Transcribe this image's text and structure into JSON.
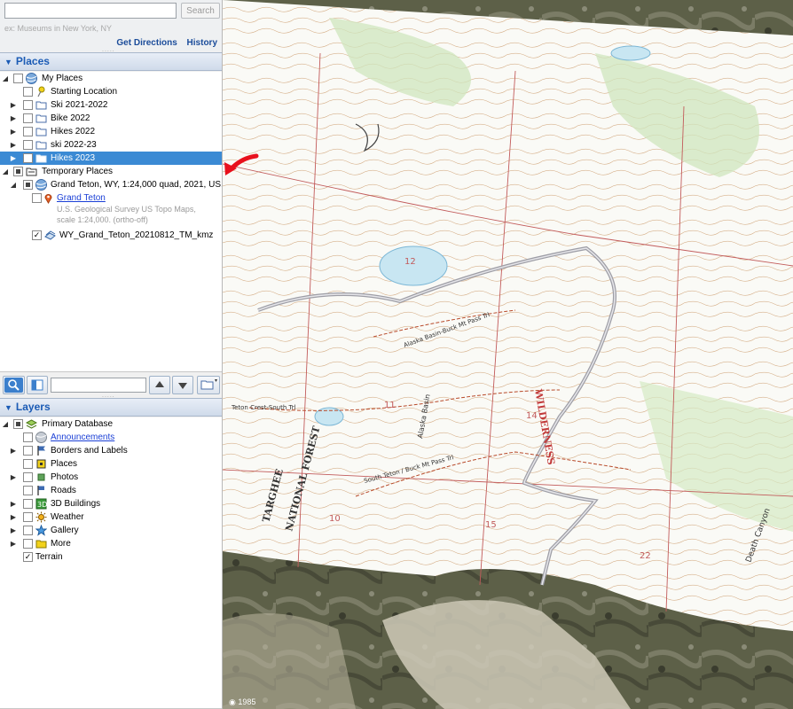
{
  "search": {
    "placeholder": "",
    "button_label": "Search",
    "hint": "ex: Museums in New York, NY",
    "get_directions": "Get Directions",
    "history": "History"
  },
  "places": {
    "header": "Places",
    "my_places": "My Places",
    "starting_location": "Starting Location",
    "ski_2021": "Ski 2021-2022",
    "bike_2022": "Bike 2022",
    "hikes_2022": "Hikes 2022",
    "ski_2022": "ski 2022-23",
    "hikes_2023": "Hikes 2023",
    "temporary_places": "Temporary Places",
    "grand_teton_quad": "Grand Teton, WY, 1:24,000 quad, 2021, US...",
    "grand_teton_link": "Grand Teton",
    "grand_teton_desc1": "U.S. Geological Survey US Topo Maps,",
    "grand_teton_desc2": "scale 1:24,000. (ortho-off)",
    "kmz_file": "WY_Grand_Teton_20210812_TM_kmz"
  },
  "layers": {
    "header": "Layers",
    "primary_database": "Primary Database",
    "announcements": "Announcements",
    "borders": "Borders and Labels",
    "places": "Places",
    "photos": "Photos",
    "roads": "Roads",
    "buildings": "3D Buildings",
    "weather": "Weather",
    "gallery": "Gallery",
    "more": "More",
    "terrain": "Terrain"
  },
  "map": {
    "labels": {
      "targhee": "TARGHEE",
      "national_forest": "NATIONAL FOREST",
      "wilderness": "WILDERNESS",
      "alaska_basin": "Alaska Basin",
      "alaska_basin_trail": "Alaska Basin-Buck Mt Pass Trl",
      "south_teton_trail": "South Teton / Buck Mt Pass Trl",
      "teton_crest": "Teton Crest-South Trl",
      "death_canyon": "Death Canyon",
      "sec_10": "10",
      "sec_11": "11",
      "sec_12": "12",
      "sec_14": "14",
      "sec_15": "15",
      "sec_22": "22"
    },
    "status_year": "1985"
  },
  "colors": {
    "selected": "#3b8ad4",
    "header_text": "#1b5bb5",
    "arrow": "#e8101c"
  }
}
